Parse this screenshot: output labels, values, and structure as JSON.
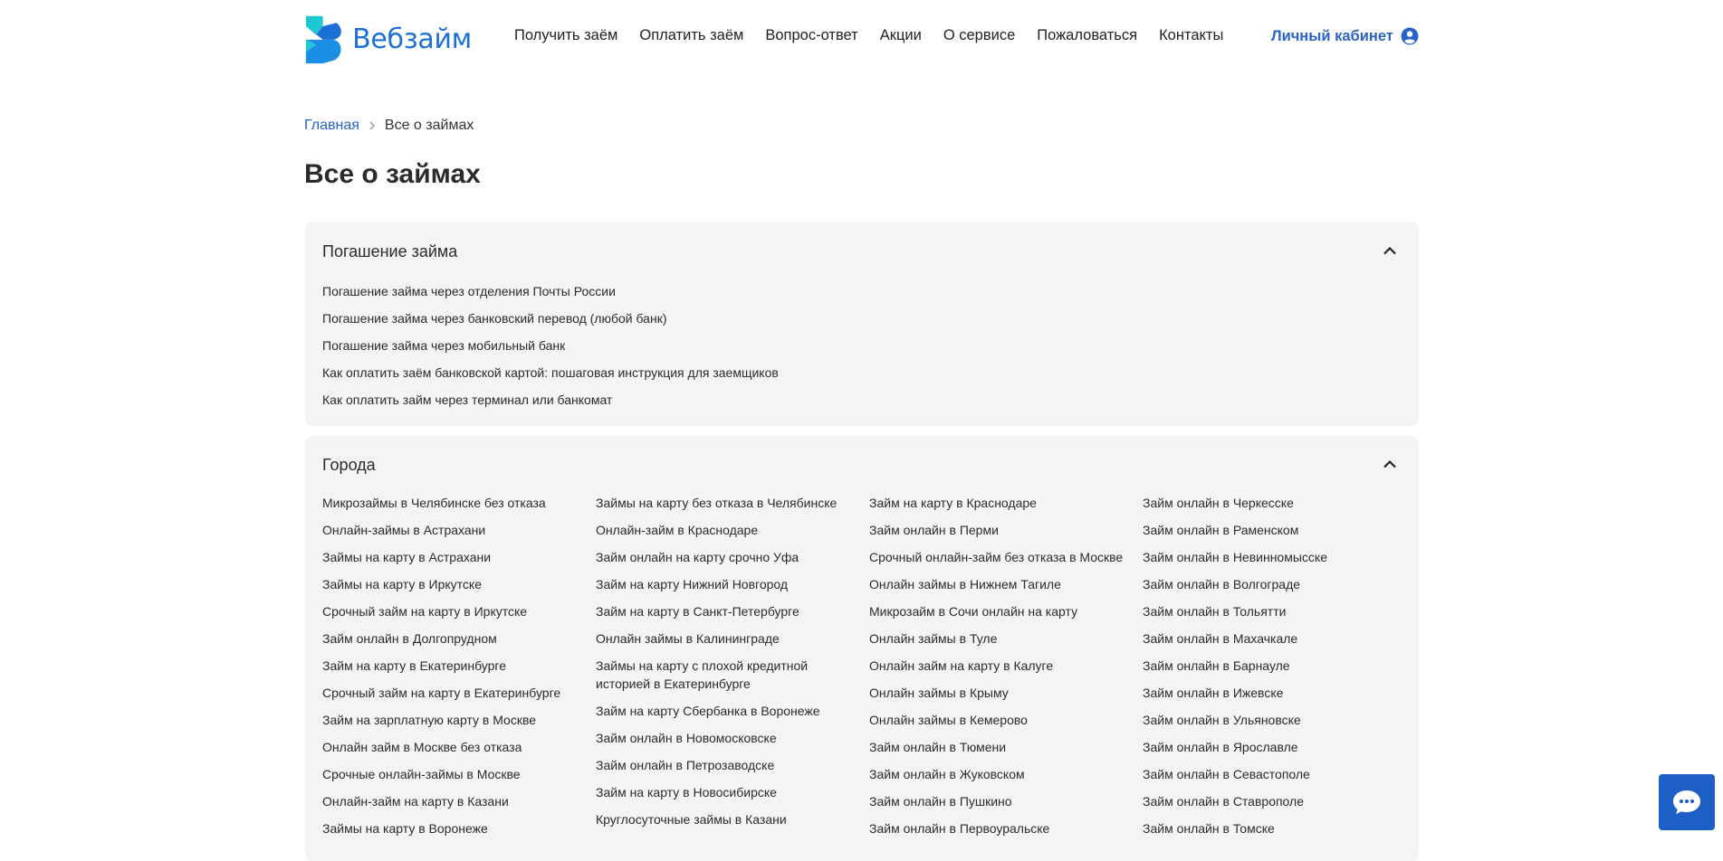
{
  "header": {
    "brand": "Вебзайм",
    "nav": [
      "Получить заём",
      "Оплатить заём",
      "Вопрос-ответ",
      "Акции",
      "О сервисе",
      "Пожаловаться",
      "Контакты"
    ],
    "cabinet_label": "Личный кабинет"
  },
  "breadcrumb": {
    "home": "Главная",
    "current": "Все о займах"
  },
  "page_title": "Все о займах",
  "repayment": {
    "title": "Погашение займа",
    "items": [
      "Погашение займа через отделения Почты России",
      "Погашение займа через банковский перевод (любой банк)",
      "Погашение займа через мобильный банк",
      "Как оплатить заём банковской картой: пошаговая инструкция для заемщиков",
      "Как оплатить займ через терминал или банкомат"
    ]
  },
  "cities": {
    "title": "Города",
    "columns": [
      [
        "Микрозаймы в Челябинске без отказа",
        "Онлайн-займы в Астрахани",
        "Займы на карту в Астрахани",
        "Займы на карту в Иркутске",
        "Срочный займ на карту в Иркутске",
        "Займ онлайн в Долгопрудном",
        "Займ на карту в Екатеринбурге",
        "Срочный займ на карту в Екатеринбурге",
        "Займ на зарплатную карту в Москве",
        "Онлайн займ в Москве без отказа",
        "Срочные онлайн-займы в Москве",
        "Онлайн-займ на карту в Казани",
        "Займы на карту в Воронеже"
      ],
      [
        "Займы на карту без отказа в Челябинске",
        "Онлайн-займ в Краснодаре",
        "Займ онлайн на карту срочно Уфа",
        "Займ на карту Нижний Новгород",
        "Займ на карту в Санкт-Петербурге",
        "Онлайн займы в Калининграде",
        "Займы на карту с плохой кредитной историей в Екатеринбурге",
        "Займ на карту Сбербанка в Воронеже",
        "Займ онлайн в Новомосковске",
        "Займ онлайн в Петрозаводске",
        "Займ на карту в Новосибирске",
        "Круглосуточные займы в Казани"
      ],
      [
        "Займ на карту в Краснодаре",
        "Займ онлайн в Перми",
        "Срочный онлайн-займ без отказа в Москве",
        "Онлайн займы в Нижнем Тагиле",
        "Микрозайм в Сочи онлайн на карту",
        "Онлайн займы в Туле",
        "Онлайн займ на карту в Калуге",
        "Онлайн займы в Крыму",
        "Онлайн займы в Кемерово",
        "Займ онлайн в Тюмени",
        "Займ онлайн в Жуковском",
        "Займ онлайн в Пушкино",
        "Займ онлайн в Первоуральске"
      ],
      [
        "Займ онлайн в Черкесске",
        "Займ онлайн в Раменском",
        "Займ онлайн в Невинномысске",
        "Займ онлайн в Волгограде",
        "Займ онлайн в Тольятти",
        "Займ онлайн в Махачкале",
        "Займ онлайн в Барнауле",
        "Займ онлайн в Ижевске",
        "Займ онлайн в Ульяновске",
        "Займ онлайн в Ярославле",
        "Займ онлайн в Севастополе",
        "Займ онлайн в Ставрополе",
        "Займ онлайн в Томске"
      ]
    ]
  },
  "colors": {
    "brand": "#1c6fd6",
    "link": "#2a63c6",
    "panel": "#f4f4f4",
    "chat": "#1d5fc4"
  },
  "icons": {
    "cabinet": "user-circle-icon",
    "chevron": "chevron-up-icon",
    "chat": "chat-bubble-icon",
    "breadcrumb_sep": "chevron-right-icon"
  }
}
